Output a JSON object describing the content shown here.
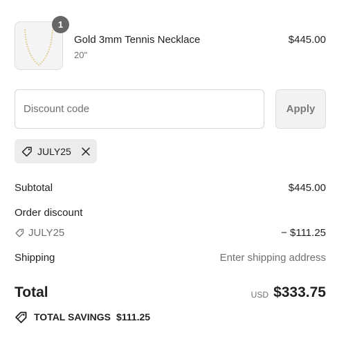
{
  "product": {
    "quantity": "1",
    "name": "Gold 3mm Tennis Necklace",
    "variant": "20\"",
    "price": "$445.00",
    "image_icon": "necklace-icon"
  },
  "discount": {
    "placeholder": "Discount code",
    "value": "",
    "apply_label": "Apply"
  },
  "applied_code": {
    "code": "JULY25",
    "tag_icon": "tag-icon",
    "remove_icon": "close-icon"
  },
  "summary": {
    "subtotal_label": "Subtotal",
    "subtotal_value": "$445.00",
    "order_discount_label": "Order discount",
    "discount_code": "JULY25",
    "discount_value": "− $111.25",
    "shipping_label": "Shipping",
    "shipping_value": "Enter shipping address",
    "total_label": "Total",
    "currency": "USD",
    "total_value": "$333.75",
    "savings_label": "TOTAL SAVINGS",
    "savings_value": "$111.25"
  },
  "colors": {
    "text": "#1f1f1f",
    "muted": "#707070",
    "badge": "#666666",
    "chip_bg": "#ececec",
    "button_bg": "#f2f2f2"
  }
}
